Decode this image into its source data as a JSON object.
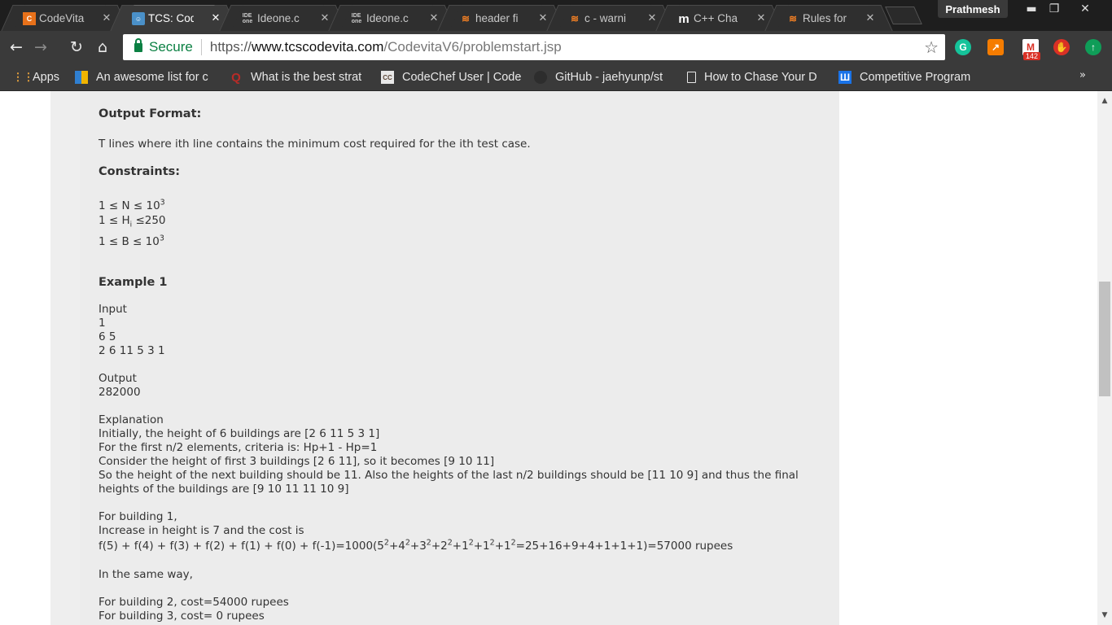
{
  "browser": {
    "tabs": [
      {
        "label": "CodeVita",
        "icon": "codevita-icon",
        "active": false
      },
      {
        "label": "TCS: Cod",
        "icon": "tcs-icon",
        "active": true
      },
      {
        "label": "Ideone.c",
        "icon": "ideone-icon",
        "active": false
      },
      {
        "label": "Ideone.c",
        "icon": "ideone-icon",
        "active": false
      },
      {
        "label": "header fi",
        "icon": "stackoverflow-icon",
        "active": false
      },
      {
        "label": "c - warni",
        "icon": "stackoverflow-icon",
        "active": false
      },
      {
        "label": "C++ Cha",
        "icon": "medium-icon",
        "active": false
      },
      {
        "label": "Rules for",
        "icon": "stackoverflow-icon",
        "active": false
      }
    ],
    "profile_name": "Prathmesh",
    "address": {
      "secure_label": "Secure",
      "scheme": "https://",
      "host": "www.tcscodevita.com",
      "path": "/CodevitaV6/problemstart.jsp"
    },
    "extension_badge": "142",
    "bookmarks": [
      {
        "label": "Apps",
        "icon": "apps-grid-icon"
      },
      {
        "label": "An awesome list for c",
        "icon": "chart-icon"
      },
      {
        "label": "What is the best strat",
        "icon": "quora-icon"
      },
      {
        "label": "CodeChef User | Code",
        "icon": "codechef-icon"
      },
      {
        "label": "GitHub - jaehyunp/st",
        "icon": "github-icon"
      },
      {
        "label": "How to Chase Your D",
        "icon": "page-icon"
      },
      {
        "label": "Competitive Program",
        "icon": "u-icon"
      }
    ],
    "bookmarks_overflow": "»"
  },
  "problem": {
    "output_format_heading": "Output Format:",
    "output_format_text": "T lines where ith line contains the minimum cost required for the ith test case.",
    "constraints_heading": "Constraints:",
    "constraint_1_lhs": "1 ≤ N ≤ 10",
    "constraint_1_exp": "3",
    "constraint_2_lhs": "1 ≤ H",
    "constraint_2_sub": "i",
    "constraint_2_rhs": " ≤250",
    "constraint_3_lhs": "1 ≤ B ≤ 10",
    "constraint_3_exp": "3",
    "example_heading": "Example 1",
    "input_label": "Input",
    "input_lines": [
      "1",
      "6 5",
      "2 6 11 5 3 1"
    ],
    "output_label": "Output",
    "output_value": "282000",
    "explanation_label": "Explanation",
    "explanation_lines": [
      "Initially, the height of 6 buildings are [2 6 11 5 3 1]",
      "For the first n/2 elements, criteria is: Hp+1 - Hp=1",
      "Consider the height of first 3 buildings [2 6 11], so it becomes [9 10 11]",
      "So the height of the next building should be 11. Also the heights of the last n/2 buildings should be [11 10 9] and thus the final",
      "heights of the buildings are [9 10 11 11 10 9]"
    ],
    "building1_label": "For building 1,",
    "building1_increase": "Increase in height is 7 and the cost is",
    "building1_formula_a": "f(5) + f(4) + f(3) + f(2) + f(1) + f(0) + f(-1)=1000(5",
    "building1_formula_b": "+4",
    "building1_formula_c": "+3",
    "building1_formula_d": "+2",
    "building1_formula_e": "+1",
    "building1_formula_f": "+1",
    "building1_formula_g": "+1",
    "building1_formula_h": "=25+16+9+4+1+1+1)=57000  rupees",
    "square_exp": "2",
    "same_way": "In the same way,",
    "building2": "For building 2, cost=54000  rupees",
    "building3": "For building 3, cost= 0  rupees"
  },
  "colors": {
    "chrome_dark": "#1e1e1e",
    "chrome_toolbar": "#3a3a3a",
    "secure_green": "#0b8043",
    "panel_bg": "#ececec"
  }
}
